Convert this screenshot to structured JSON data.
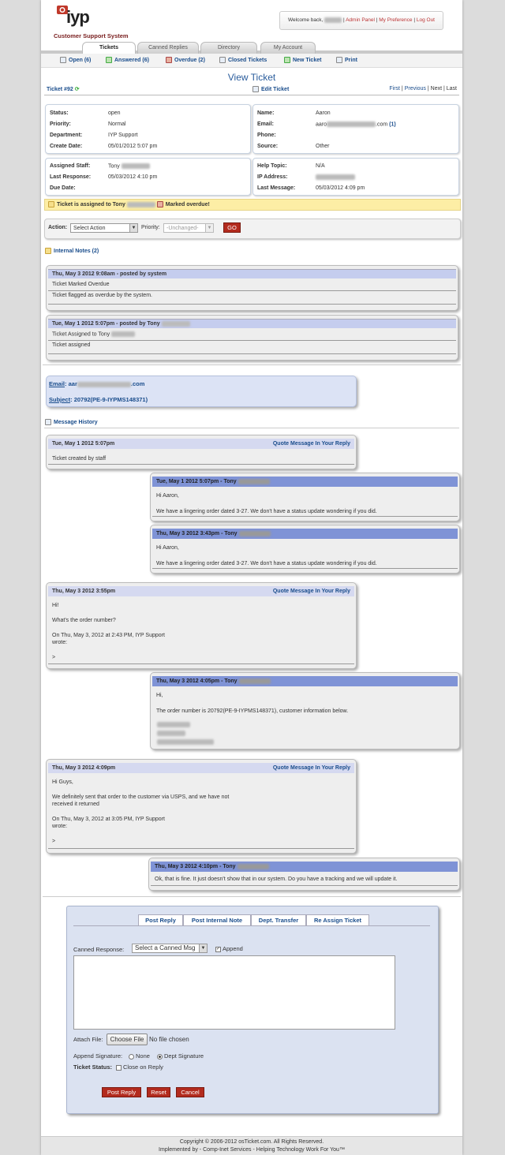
{
  "header": {
    "logo_text": "iyp",
    "brand_line": "Customer Support System",
    "welcome": "Welcome back,",
    "admin_panel": "Admin Panel",
    "my_preference": "My Preference",
    "logout": "Log Out"
  },
  "top_tabs": [
    "Tickets",
    "Canned Replies",
    "Directory",
    "My Account"
  ],
  "subnav": {
    "open": "Open (6)",
    "answered": "Answered (6)",
    "overdue": "Overdue (2)",
    "closed": "Closed Tickets",
    "new_ticket": "New Ticket",
    "print": "Print"
  },
  "page_title": "View Ticket",
  "ticket_bar": {
    "ticket_no": "Ticket #92",
    "edit": "Edit Ticket",
    "first": "First",
    "previous": "Previous",
    "next": "Next",
    "last": "Last"
  },
  "info": {
    "status_label": "Status:",
    "status": "open",
    "priority_label": "Priority:",
    "priority": "Normal",
    "department_label": "Department:",
    "department": "IYP Support",
    "create_date_label": "Create Date:",
    "create_date": "05/01/2012 5:07 pm",
    "name_label": "Name:",
    "name": "Aaron",
    "email_label": "Email:",
    "email_prefix": "aaro",
    "email_suffix": ".com",
    "email_count": "(1)",
    "phone_label": "Phone:",
    "source_label": "Source:",
    "source": "Other",
    "assigned_label": "Assigned Staff:",
    "assigned": "Tony",
    "last_response_label": "Last Response:",
    "last_response": "05/03/2012 4:10 pm",
    "due_date_label": "Due Date:",
    "help_topic_label": "Help Topic:",
    "help_topic": "N/A",
    "ip_label": "IP Address:",
    "last_message_label": "Last Message:",
    "last_message": "05/03/2012 4:09 pm"
  },
  "notice": {
    "assigned": "Ticket is assigned to Tony",
    "overdue": "Marked overdue!"
  },
  "action_bar": {
    "action_label": "Action:",
    "action_value": "Select Action",
    "priority_label": "Priority:",
    "priority_value": "-Unchanged-",
    "go": "GO"
  },
  "internal_notes": {
    "heading": "Internal Notes (2)",
    "notes": [
      {
        "header": "Thu, May 3 2012 9:08am -  posted by system",
        "title": "Ticket Marked Overdue",
        "body": "Ticket flagged as overdue by the system."
      },
      {
        "header": "Tue, May 1 2012 5:07pm -  posted by Tony",
        "title": "Ticket Assigned to Tony",
        "body": "Ticket assigned"
      }
    ]
  },
  "email_box": {
    "email_label": "Email",
    "email_prefix": "aar",
    "email_suffix": ".com",
    "subject_label": "Subject",
    "subject": "20792(PE-9-IYPMS148371)"
  },
  "message_history": {
    "heading": "Message History",
    "quote_label": "Quote Message In Your Reply",
    "messages": [
      {
        "header": "Tue, May 1 2012 5:07pm",
        "lines": [
          "Ticket created by staff"
        ]
      },
      {
        "header": "Tue, May 1 2012 5:07pm - Tony",
        "lines": [
          "Hi Aaron,",
          "We have a lingering order dated 3-27. We don't have a status update wondering if you did."
        ]
      },
      {
        "header": "Thu, May 3 2012 3:43pm - Tony",
        "lines": [
          "Hi Aaron,",
          "We have a lingering order dated 3-27. We don't have a status update wondering if you did."
        ]
      },
      {
        "header": "Thu, May 3 2012 3:55pm",
        "lines": [
          "Hi!",
          "What's the order number?",
          "On Thu, May 3, 2012 at 2:43 PM, IYP Support",
          "wrote:",
          ">"
        ]
      },
      {
        "header": "Thu, May 3 2012 4:05pm - Tony",
        "lines": [
          "Hi,",
          "The order number is 20792(PE-9-IYPMS148371), customer information below."
        ]
      },
      {
        "header": "Thu, May 3 2012 4:09pm",
        "lines": [
          "Hi Guys,",
          "We definitely sent that order to the customer via USPS, and we have not",
          "received it returned",
          "On Thu, May 3, 2012 at 3:05 PM, IYP Support",
          "wrote:",
          ">"
        ]
      },
      {
        "header": "Thu, May 3 2012 4:10pm - Tony",
        "lines": [
          "Ok, that is fine. It just doesn't show that in our system. Do you have a tracking and we will update it."
        ]
      }
    ]
  },
  "reply": {
    "tabs": [
      "Post Reply",
      "Post Internal Note",
      "Dept. Transfer",
      "Re Assign Ticket"
    ],
    "canned_label": "Canned Response:",
    "canned_value": "Select a Canned Msg",
    "append": "Append",
    "attach_label": "Attach File:",
    "choose_file": "Choose File",
    "no_file": "No file chosen",
    "signature_label": "Append Signature:",
    "sig_none": "None",
    "sig_dept": "Dept Signature",
    "status_label": "Ticket Status:",
    "close_on_reply": "Close on Reply",
    "post_reply_btn": "Post Reply",
    "reset_btn": "Reset",
    "cancel_btn": "Cancel"
  },
  "footer": {
    "copyright": "Copyright © 2006-2012 osTicket.com.  All Rights Reserved.",
    "implemented": "Implemented by - Comp-Inet Services - Helping Technology Work For You™"
  }
}
